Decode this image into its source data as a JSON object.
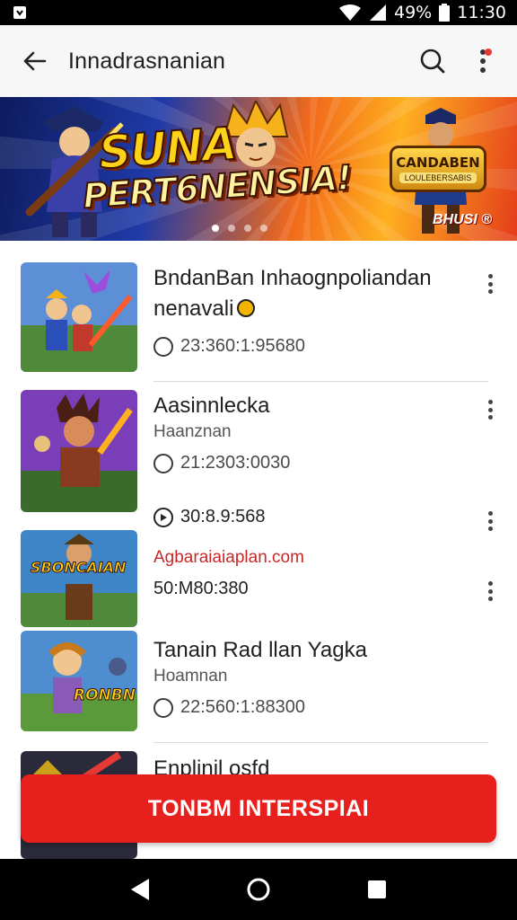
{
  "status_bar": {
    "battery": "49%",
    "time": "11:30"
  },
  "app_bar": {
    "title": "Innadrasnanian"
  },
  "banner": {
    "title_line1": "SUNA",
    "title_line2": "PERT6NENSIA!",
    "badge_title": "CANDABEN",
    "badge_sub": "LOULEBERSABIS",
    "tag": "BHUSI ®",
    "slide_count": 4,
    "active_slide": 1
  },
  "items": [
    {
      "title": "BndanBan Inhaognpoliandan",
      "title_line2": "nenavali",
      "meta": "23:360:1:95680"
    },
    {
      "title": "Aasinnlecka",
      "subtitle": "Haanznan",
      "meta": "21:2303:0030"
    },
    {
      "meta_top": "30:8.9:568",
      "link": "Agbaraiaiaplan.com",
      "meta": "50:M80:380",
      "thumb_caption": "SBONCAIAN"
    },
    {
      "title": "Tanain Rad llan Yagka",
      "subtitle": "Hoamnan",
      "meta": "22:560:1:88300",
      "thumb_caption": "RONBN"
    },
    {
      "title": "Enplinil osfd"
    }
  ],
  "cta": {
    "label": "TONBM INTERSPIAI"
  },
  "colors": {
    "accent": "#e8201d",
    "link": "#c62828"
  },
  "icons": {
    "back": "arrow-left-icon",
    "search": "search-icon",
    "more": "more-vert-icon",
    "nav_back": "triangle-back-icon",
    "nav_home": "circle-home-icon",
    "nav_recent": "square-recents-icon"
  }
}
